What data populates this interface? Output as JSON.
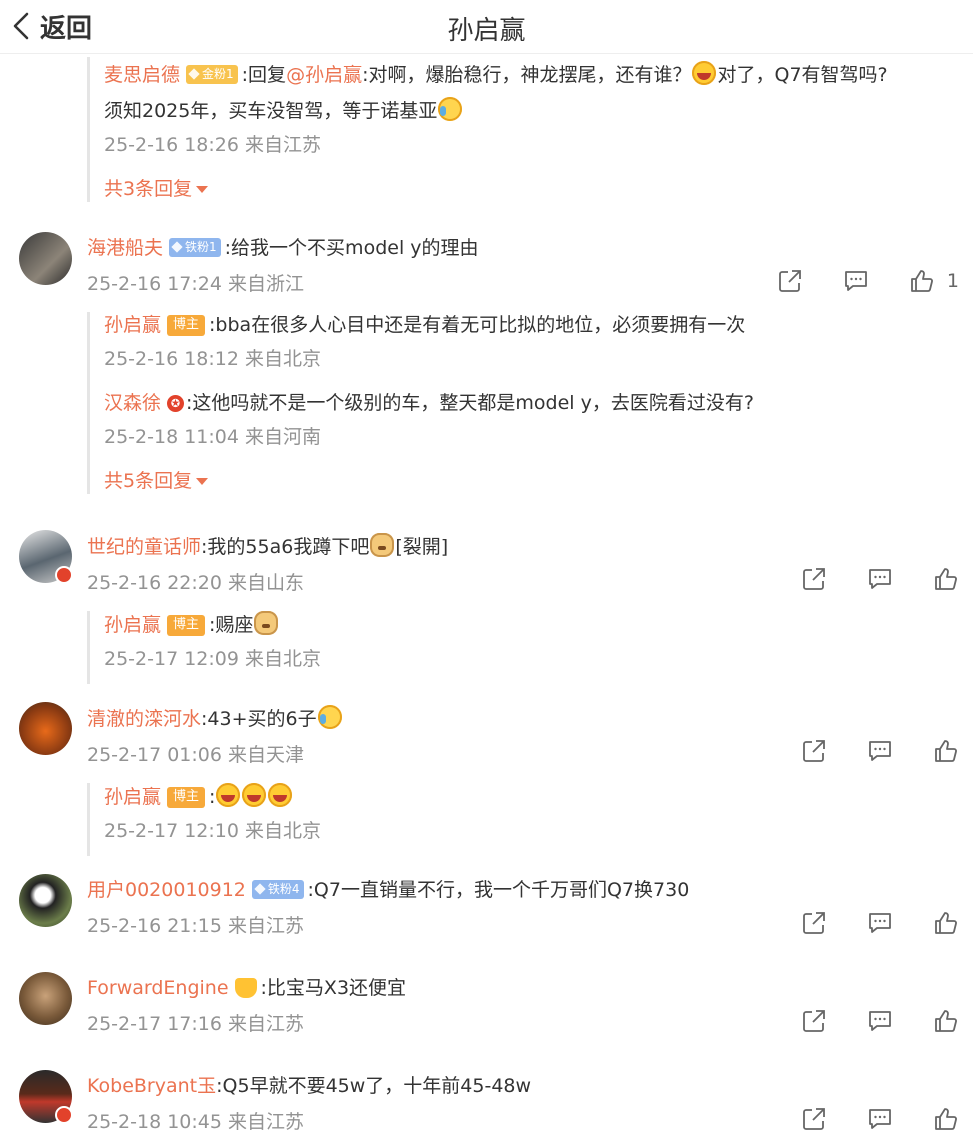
{
  "header": {
    "back_label": "返回",
    "title": "孙启赢"
  },
  "top_reply": {
    "name": "麦思启德",
    "badge": "金粉1",
    "text_1": ":回复",
    "mention": "@孙启赢",
    "text_2": ":对啊，爆胎稳行，神龙摆尾，还有谁？",
    "text_3": "对了，Q7有智驾吗?",
    "text_4": "须知2025年，买车没智驾，等于诺基亚",
    "time": "25-2-16 18:26 来自江苏",
    "more": "共3条回复"
  },
  "comments": [
    {
      "name": "海港船夫",
      "badge": "铁粉1",
      "text": ":给我一个不买model y的理由",
      "time": "25-2-16 17:24 来自浙江",
      "likes": "1",
      "replies": [
        {
          "name": "孙启赢",
          "badge": "博主",
          "text": ":bba在很多人心目中还是有着无可比拟的地位，必须要拥有一次",
          "time": "25-2-16 18:12 来自北京"
        },
        {
          "name": "汉森徐",
          "text": ":这他吗就不是一个级别的车，整天都是model y，去医院看过没有?",
          "time": "25-2-18 11:04 来自河南"
        }
      ],
      "more": "共5条回复"
    },
    {
      "name": "世纪的童话师",
      "text": ":我的55a6我蹲下吧",
      "text_2": "[裂開]",
      "time": "25-2-16 22:20 来自山东",
      "replies": [
        {
          "name": "孙启赢",
          "badge": "博主",
          "text": ":赐座",
          "time": "25-2-17 12:09 来自北京"
        }
      ]
    },
    {
      "name": "清澈的滦河水",
      "text": ":43+买的6子",
      "time": "25-2-17 01:06 来自天津",
      "replies": [
        {
          "name": "孙启赢",
          "badge": "博主",
          "text": ":",
          "time": "25-2-17 12:10 来自北京"
        }
      ]
    },
    {
      "name": "用户0020010912",
      "badge": "铁粉4",
      "text": ":Q7一直销量不行，我一个千万哥们Q7换730",
      "time": "25-2-16 21:15 来自江苏"
    },
    {
      "name": "ForwardEngine",
      "text": ":比宝马X3还便宜",
      "time": "25-2-17 17:16 来自江苏"
    },
    {
      "name": "KobeBryant玉",
      "text": ":Q5早就不要45w了，十年前45-48w",
      "time": "25-2-18 10:45 来自江苏"
    }
  ],
  "colors": {
    "name": "#eb7350",
    "meta": "#939393",
    "host_badge": "#f7a93a",
    "fan_badge_gold": "#f8c34e",
    "fan_badge_iron": "#8fb6ee"
  },
  "icons": [
    "back-arrow-icon",
    "share-icon",
    "comment-icon",
    "like-icon"
  ]
}
